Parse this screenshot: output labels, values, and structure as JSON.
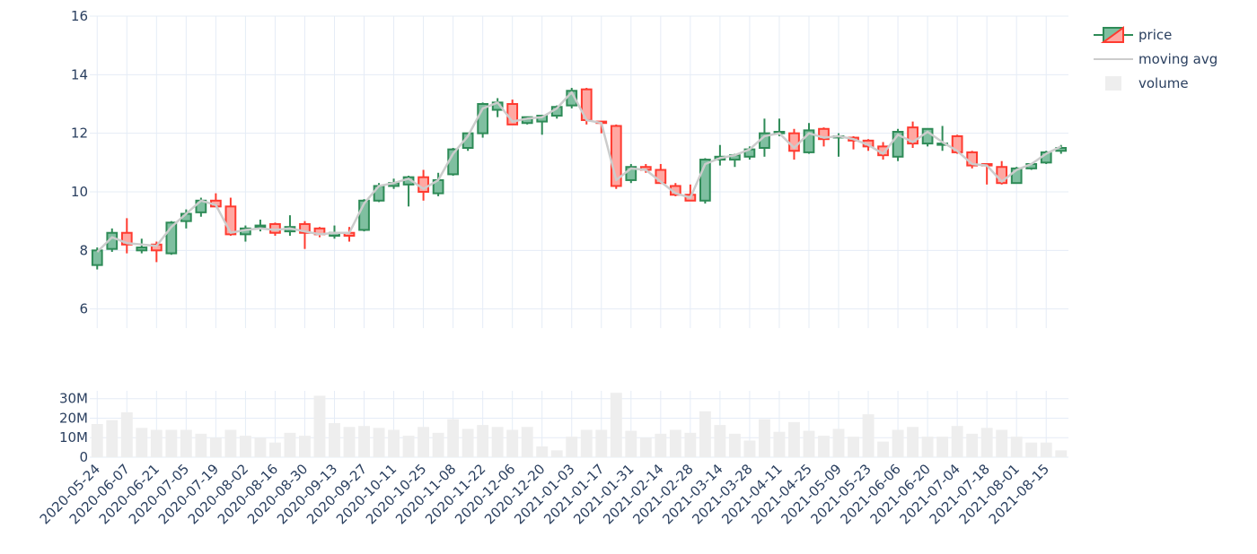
{
  "chart_data": {
    "type": "candlestick",
    "x": [
      "2020-05-24",
      "2020-05-31",
      "2020-06-07",
      "2020-06-14",
      "2020-06-21",
      "2020-06-28",
      "2020-07-05",
      "2020-07-12",
      "2020-07-19",
      "2020-07-26",
      "2020-08-02",
      "2020-08-09",
      "2020-08-16",
      "2020-08-23",
      "2020-08-30",
      "2020-09-06",
      "2020-09-13",
      "2020-09-20",
      "2020-09-27",
      "2020-10-04",
      "2020-10-11",
      "2020-10-18",
      "2020-10-25",
      "2020-11-01",
      "2020-11-08",
      "2020-11-15",
      "2020-11-22",
      "2020-11-29",
      "2020-12-06",
      "2020-12-13",
      "2020-12-20",
      "2020-12-27",
      "2021-01-03",
      "2021-01-10",
      "2021-01-17",
      "2021-01-24",
      "2021-01-31",
      "2021-02-07",
      "2021-02-14",
      "2021-02-21",
      "2021-02-28",
      "2021-03-07",
      "2021-03-14",
      "2021-03-21",
      "2021-03-28",
      "2021-04-04",
      "2021-04-11",
      "2021-04-18",
      "2021-04-25",
      "2021-05-02",
      "2021-05-09",
      "2021-05-16",
      "2021-05-23",
      "2021-05-30",
      "2021-06-06",
      "2021-06-13",
      "2021-06-20",
      "2021-06-27",
      "2021-07-04",
      "2021-07-11",
      "2021-07-18",
      "2021-07-25",
      "2021-08-01",
      "2021-08-08",
      "2021-08-15",
      "2021-08-22"
    ],
    "open": [
      7.5,
      8.05,
      8.6,
      8.0,
      8.2,
      7.9,
      9.0,
      9.3,
      9.7,
      9.5,
      8.55,
      8.8,
      8.9,
      8.65,
      8.9,
      8.75,
      8.5,
      8.6,
      8.7,
      9.7,
      10.2,
      10.25,
      10.5,
      9.95,
      10.6,
      11.5,
      12.0,
      12.8,
      13.0,
      12.35,
      12.4,
      12.6,
      12.95,
      13.5,
      12.4,
      12.25,
      10.4,
      10.85,
      10.75,
      10.2,
      9.9,
      9.7,
      11.1,
      11.1,
      11.2,
      11.5,
      12.0,
      12.0,
      11.35,
      12.15,
      11.9,
      11.85,
      11.75,
      11.55,
      11.2,
      12.2,
      11.65,
      11.65,
      11.9,
      11.35,
      10.95,
      10.85,
      10.3,
      10.8,
      11.0,
      11.4
    ],
    "high": [
      8.1,
      8.75,
      9.1,
      8.4,
      8.3,
      9.0,
      9.4,
      9.8,
      9.95,
      9.8,
      8.85,
      9.05,
      8.95,
      9.2,
      9.0,
      8.8,
      8.85,
      8.8,
      9.75,
      10.3,
      10.45,
      10.55,
      10.75,
      10.65,
      11.5,
      12.0,
      13.05,
      13.2,
      13.15,
      12.5,
      12.55,
      12.95,
      13.55,
      13.55,
      12.4,
      12.3,
      10.95,
      10.95,
      10.95,
      10.3,
      10.25,
      11.15,
      11.6,
      11.3,
      11.55,
      12.5,
      12.5,
      12.15,
      12.35,
      12.2,
      12.0,
      11.9,
      11.8,
      11.7,
      12.15,
      12.4,
      11.75,
      12.25,
      11.95,
      11.4,
      10.95,
      11.05,
      10.85,
      10.9,
      11.4,
      11.6
    ],
    "low": [
      7.35,
      7.95,
      7.9,
      7.9,
      7.6,
      7.85,
      8.75,
      9.15,
      9.5,
      8.5,
      8.3,
      8.65,
      8.5,
      8.5,
      8.05,
      8.45,
      8.4,
      8.3,
      8.65,
      9.65,
      10.1,
      9.5,
      9.7,
      9.85,
      10.55,
      11.4,
      11.85,
      12.55,
      12.3,
      12.3,
      11.95,
      12.5,
      12.85,
      12.3,
      12.0,
      10.1,
      10.3,
      10.65,
      10.5,
      9.85,
      9.7,
      9.6,
      10.9,
      10.85,
      11.1,
      11.2,
      11.9,
      11.1,
      11.3,
      11.55,
      11.2,
      11.45,
      11.4,
      11.1,
      11.05,
      11.5,
      11.55,
      11.4,
      11.3,
      10.8,
      10.25,
      10.25,
      10.3,
      10.75,
      10.95,
      11.3
    ],
    "close": [
      8.0,
      8.6,
      8.2,
      8.1,
      8.0,
      8.95,
      9.25,
      9.7,
      9.5,
      8.55,
      8.75,
      8.85,
      8.6,
      8.8,
      8.6,
      8.55,
      8.6,
      8.5,
      9.7,
      10.2,
      10.3,
      10.5,
      10.0,
      10.4,
      11.45,
      12.0,
      13.0,
      13.05,
      12.3,
      12.55,
      12.6,
      12.9,
      13.45,
      12.45,
      12.35,
      10.2,
      10.85,
      10.75,
      10.3,
      9.9,
      9.7,
      11.1,
      11.2,
      11.25,
      11.45,
      12.0,
      12.05,
      11.4,
      12.1,
      11.8,
      11.9,
      11.75,
      11.55,
      11.25,
      12.05,
      11.65,
      12.15,
      11.65,
      11.35,
      10.9,
      10.9,
      10.3,
      10.8,
      10.95,
      11.35,
      11.5
    ],
    "moving_avg": [
      7.95,
      8.45,
      8.25,
      8.2,
      8.15,
      8.8,
      9.25,
      9.7,
      9.55,
      8.6,
      8.7,
      8.75,
      8.7,
      8.75,
      8.65,
      8.55,
      8.6,
      8.6,
      9.6,
      10.2,
      10.3,
      10.45,
      10.1,
      10.4,
      11.3,
      11.9,
      12.85,
      13.05,
      12.4,
      12.5,
      12.55,
      12.85,
      13.4,
      12.45,
      12.35,
      10.4,
      10.8,
      10.75,
      10.35,
      9.95,
      9.8,
      10.95,
      11.15,
      11.25,
      11.45,
      11.9,
      12.0,
      11.5,
      12.0,
      11.85,
      11.9,
      11.8,
      11.6,
      11.3,
      11.95,
      11.7,
      12.05,
      11.7,
      11.4,
      10.95,
      10.9,
      10.35,
      10.75,
      10.95,
      11.3,
      11.55
    ],
    "volume": [
      17,
      19,
      23,
      15,
      14,
      14,
      14,
      12,
      10,
      14,
      11,
      10,
      7.5,
      12.5,
      11,
      31.5,
      17.5,
      15.5,
      16,
      15,
      14,
      11,
      15.5,
      12.5,
      19.5,
      14.5,
      16.5,
      15.5,
      14,
      15.5,
      5.5,
      3.5,
      10.5,
      14,
      14,
      33,
      13.5,
      10,
      12,
      14,
      12.5,
      23.5,
      16.5,
      12,
      8.5,
      19.5,
      13,
      18,
      13.5,
      11,
      14.5,
      10.5,
      22,
      8,
      14,
      15.5,
      10.5,
      10.5,
      16,
      12,
      15,
      14,
      10.5,
      7.5,
      7.5,
      3.5
    ],
    "price_ylim": [
      5.5,
      16
    ],
    "volume_ylim": [
      0,
      34
    ],
    "price_yticks": [
      "6",
      "8",
      "10",
      "12",
      "14",
      "16"
    ],
    "volume_yticks": [
      "0",
      "10M",
      "20M",
      "30M"
    ],
    "xtick_labels": [
      "2020-05-24",
      "2020-06-07",
      "2020-06-21",
      "2020-07-05",
      "2020-07-19",
      "2020-08-02",
      "2020-08-16",
      "2020-08-30",
      "2020-09-13",
      "2020-09-27",
      "2020-10-11",
      "2020-10-25",
      "2020-11-08",
      "2020-11-22",
      "2020-12-06",
      "2020-12-20",
      "2021-01-03",
      "2021-01-17",
      "2021-01-31",
      "2021-02-14",
      "2021-02-28",
      "2021-03-14",
      "2021-03-28",
      "2021-04-11",
      "2021-04-25",
      "2021-05-09",
      "2021-05-23",
      "2021-06-06",
      "2021-06-20",
      "2021-07-04",
      "2021-07-18",
      "2021-08-01",
      "2021-08-15"
    ],
    "legend": [
      {
        "key": "price",
        "label": "price"
      },
      {
        "key": "moving_avg",
        "label": "moving avg"
      },
      {
        "key": "volume",
        "label": "volume"
      }
    ],
    "legend_position": "top-right",
    "grid": true
  },
  "colors": {
    "increasing_line": "#2e8b57",
    "increasing_fill": "#7fbfa0",
    "decreasing_line": "#ff3b30",
    "decreasing_fill": "#ffa8a2",
    "moving_avg": "#cccccc",
    "volume": "#eeeeee",
    "grid": "#e5ecf6",
    "text": "#2a3f5f"
  }
}
